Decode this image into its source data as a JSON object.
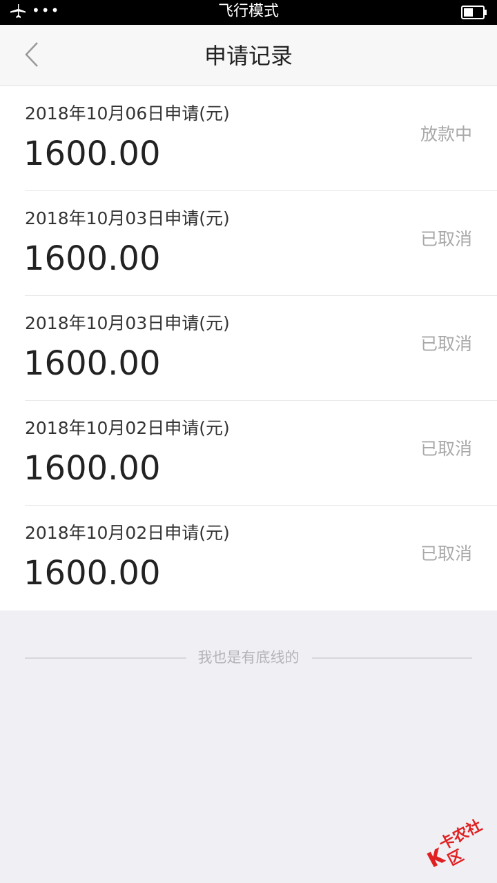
{
  "status_bar": {
    "left_icon": "airplane-icon",
    "dots": "•••",
    "title": "飞行模式",
    "battery_level": 0.5
  },
  "nav": {
    "back_icon": "chevron-left-icon",
    "title": "申请记录"
  },
  "records": [
    {
      "date": "2018年10月06日申请(元)",
      "amount": "1600.00",
      "status": "放款中"
    },
    {
      "date": "2018年10月03日申请(元)",
      "amount": "1600.00",
      "status": "已取消"
    },
    {
      "date": "2018年10月03日申请(元)",
      "amount": "1600.00",
      "status": "已取消"
    },
    {
      "date": "2018年10月02日申请(元)",
      "amount": "1600.00",
      "status": "已取消"
    },
    {
      "date": "2018年10月02日申请(元)",
      "amount": "1600.00",
      "status": "已取消"
    }
  ],
  "footer": {
    "end_text": "我也是有底线的"
  },
  "watermark": {
    "text": "卡农社区"
  },
  "colors": {
    "status_bar_bg": "#000000",
    "nav_bg": "#f7f7f7",
    "page_bg": "#efeff4",
    "status_text": "#a8a8a8",
    "watermark": "#e02020"
  }
}
